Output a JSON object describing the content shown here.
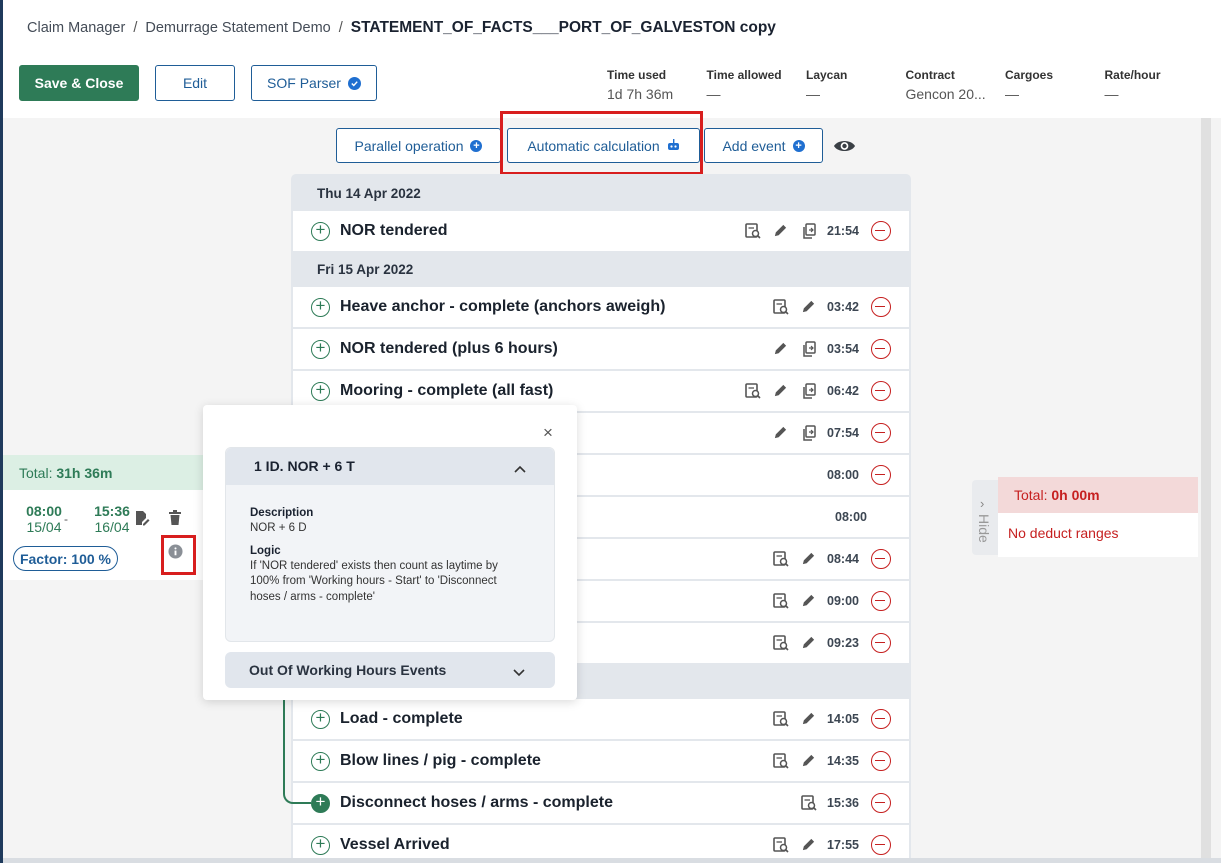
{
  "breadcrumb": {
    "items": [
      "Claim Manager",
      "Demurrage Statement Demo"
    ],
    "separator": "/",
    "current": "STATEMENT_OF_FACTS___PORT_OF_GALVESTON copy"
  },
  "toolbar": {
    "save_close": "Save & Close",
    "edit": "Edit",
    "sof_parser": "SOF Parser"
  },
  "stats": [
    {
      "label": "Time used",
      "value": "1d 7h 36m"
    },
    {
      "label": "Time allowed",
      "value": "—"
    },
    {
      "label": "Laycan",
      "value": "—"
    },
    {
      "label": "Contract",
      "value": "Gencon 20..."
    },
    {
      "label": "Cargoes",
      "value": "—"
    },
    {
      "label": "Rate/hour",
      "value": "—"
    }
  ],
  "actions": {
    "parallel_operation": "Parallel operation",
    "automatic_calculation": "Automatic calculation",
    "add_event": "Add event"
  },
  "timeline": {
    "days": [
      "Thu 14 Apr 2022",
      "Fri 15 Apr 2022"
    ],
    "events": [
      {
        "name": "NOR tendered",
        "time": "21:54"
      },
      {
        "name": "Heave anchor - complete (anchors aweigh)",
        "time": "03:42"
      },
      {
        "name": "NOR tendered (plus 6 hours)",
        "time": "03:54"
      },
      {
        "name": "Mooring - complete (all fast)",
        "time": "06:42"
      },
      {
        "name": "",
        "time": "07:54"
      },
      {
        "name": "",
        "time": "08:00"
      },
      {
        "name": "",
        "time": "08:00"
      },
      {
        "name": "",
        "time": "08:44"
      },
      {
        "name": "",
        "time": "09:00"
      },
      {
        "name": "",
        "time": "09:23"
      },
      {
        "name": "Load - complete",
        "time": "14:05"
      },
      {
        "name": "Blow lines / pig - complete",
        "time": "14:35"
      },
      {
        "name": "Disconnect hoses / arms - complete",
        "time": "15:36"
      },
      {
        "name": "Vessel Arrived",
        "time": "17:55"
      }
    ]
  },
  "laytime_panel": {
    "total_label": "Total:",
    "total_value": "31h 36m",
    "start_time": "08:00",
    "start_date": "15/04",
    "dash": "-",
    "end_time": "15:36",
    "end_date": "16/04",
    "factor": "Factor: 100 %"
  },
  "popup": {
    "close": "×",
    "rule_title": "1 ID. NOR + 6 T",
    "description_label": "Description",
    "description": "NOR + 6 D",
    "logic_label": "Logic",
    "logic": "If 'NOR tendered' exists then count as laytime by 100% from 'Working hours - Start' to 'Disconnect hoses / arms - complete'",
    "out_of_hours": "Out Of Working Hours Events"
  },
  "deduct_panel": {
    "hide": "Hide",
    "total_label": "Total:",
    "total_value": "0h 00m",
    "message": "No deduct ranges"
  },
  "colors": {
    "green": "#2e7b57",
    "blue": "#1f5d97",
    "red": "#c62020",
    "highlight": "#d81e1e"
  }
}
